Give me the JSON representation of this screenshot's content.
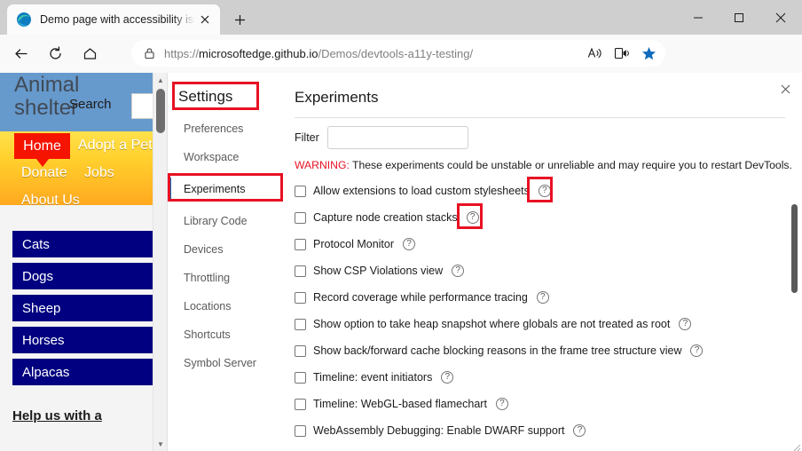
{
  "browser": {
    "tab": {
      "title": "Demo page with accessibility issues",
      "favicon_icon": "edge-logo-icon",
      "close_icon": "close-icon"
    },
    "new_tab_label": "+",
    "window_controls": {
      "minimize": "─",
      "maximize": "□",
      "close": "✕"
    },
    "nav": {
      "back_icon": "back-arrow-icon",
      "refresh_icon": "refresh-icon",
      "home_icon": "home-icon",
      "lock_icon": "lock-icon",
      "url_prefix": "https://",
      "url_host": "microsoftedge.github.io",
      "url_path": "/Demos/devtools-a11y-testing/",
      "read_aloud_icon": "read-aloud-icon",
      "immersive_reader_icon": "immersive-reader-icon",
      "favorites_icon": "star-icon",
      "copilot_icon": "copilot-sparkle-icon",
      "settings_icon": "ellipsis-icon"
    }
  },
  "webpage": {
    "site_title": "Animal shelter",
    "search_label": "Search",
    "search_value": "",
    "nav_items": [
      {
        "label": "Home",
        "active": true
      },
      {
        "label": "Adopt a Pet",
        "active": false
      },
      {
        "label": "Donate",
        "active": false
      },
      {
        "label": "Jobs",
        "active": false
      },
      {
        "label": "About Us",
        "active": false
      }
    ],
    "animals": [
      "Cats",
      "Dogs",
      "Sheep",
      "Horses",
      "Alpacas"
    ],
    "footer_text": "Help us with a",
    "scroll_up_icon": "chevron-up-icon",
    "scroll_down_icon": "chevron-down-icon"
  },
  "devtools": {
    "title": "Settings",
    "close_icon": "close-icon",
    "sidebar_items": [
      {
        "label": "Preferences",
        "selected": false
      },
      {
        "label": "Workspace",
        "selected": false
      },
      {
        "label": "Experiments",
        "selected": true
      },
      {
        "label": "Library Code",
        "selected": false
      },
      {
        "label": "Devices",
        "selected": false
      },
      {
        "label": "Throttling",
        "selected": false
      },
      {
        "label": "Locations",
        "selected": false
      },
      {
        "label": "Shortcuts",
        "selected": false
      },
      {
        "label": "Symbol Server",
        "selected": false
      }
    ],
    "panel": {
      "heading": "Experiments",
      "filter_label": "Filter",
      "filter_value": "",
      "filter_placeholder": "",
      "warning_prefix": "WARNING:",
      "warning_text": " These experiments could be unstable or unreliable and may require you to restart DevTools.",
      "help_icon": "question-mark-icon",
      "experiments": [
        {
          "label": "Allow extensions to load custom stylesheets",
          "checked": false
        },
        {
          "label": "Capture node creation stacks",
          "checked": false
        },
        {
          "label": "Protocol Monitor",
          "checked": false
        },
        {
          "label": "Show CSP Violations view",
          "checked": false
        },
        {
          "label": "Record coverage while performance tracing",
          "checked": false
        },
        {
          "label": "Show option to take heap snapshot where globals are not treated as root",
          "checked": false
        },
        {
          "label": "Show back/forward cache blocking reasons in the frame tree structure view",
          "checked": false
        },
        {
          "label": "Timeline: event initiators",
          "checked": false
        },
        {
          "label": "Timeline: WebGL-based flamechart",
          "checked": false
        },
        {
          "label": "WebAssembly Debugging: Enable DWARF support",
          "checked": false
        }
      ]
    }
  },
  "annotations": {
    "accent_color": "#e81123",
    "boxes": [
      "settings-title",
      "experiments-sidebar-item",
      "allow-extensions-help-icon",
      "capture-node-help-icon"
    ]
  }
}
